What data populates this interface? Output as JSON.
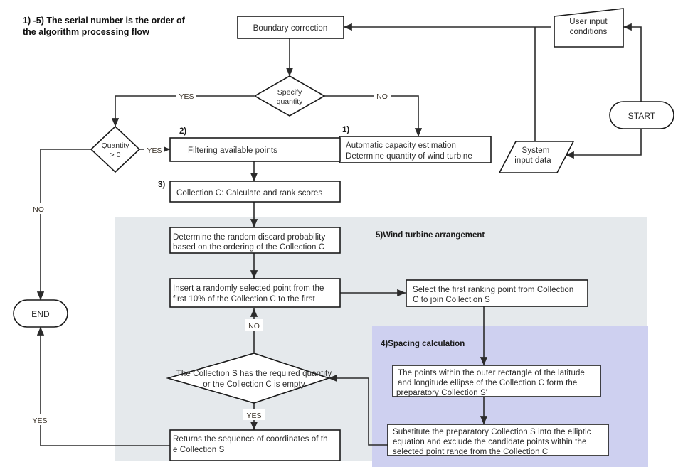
{
  "header": {
    "note_line1": "1)  -5)  The serial number is the order of",
    "note_line2": "the algorithm processing flow"
  },
  "bands": [
    {
      "id": "wind-turbine-arrangement",
      "label": "5)Wind turbine arrangement",
      "color": "#e5e9ec"
    },
    {
      "id": "spacing-calculation",
      "label": "4)Spacing calculation",
      "color": "#ced0f0"
    }
  ],
  "nodes": {
    "start": {
      "label": "START",
      "shape": "terminator"
    },
    "end": {
      "label": "END",
      "shape": "terminator"
    },
    "user_input": {
      "label_line1": "User input",
      "label_line2": "conditions",
      "shape": "trapezoid"
    },
    "system_input": {
      "label_line1": "System",
      "label_line2": "input data",
      "shape": "parallelogram"
    },
    "boundary_correction": {
      "label": "Boundary correction",
      "shape": "process"
    },
    "specify_quantity": {
      "label_line1": "Specify",
      "label_line2": "quantity",
      "shape": "decision"
    },
    "quantity_gt_zero": {
      "label_line1": "Quantity",
      "label_line2": "> 0",
      "shape": "decision"
    },
    "auto_capacity": {
      "step": "1)",
      "label_line1": "Automatic capacity estimation",
      "label_line2": "Determine quantity of wind turbine",
      "shape": "process"
    },
    "filtering_points": {
      "step": "2)",
      "label": "Filtering available points",
      "shape": "process"
    },
    "collection_c_scores": {
      "step": "3)",
      "label": "Collection C:   Calculate and rank scores",
      "shape": "process"
    },
    "discard_probability": {
      "label_line1": "Determine the random discard probability",
      "label_line2": "based on the ordering of the Collection C",
      "shape": "process"
    },
    "insert_random_point": {
      "label_line1": "Insert a randomly selected point from the",
      "label_line2": "first 10% of the Collection C to the first",
      "shape": "process"
    },
    "select_first_ranking": {
      "label_line1": "Select the first ranking point from Collection",
      "label_line2": " C to join Collection S",
      "shape": "process"
    },
    "outer_rectangle_points": {
      "label_line1": "The points within the outer rectangle of the latitude",
      "label_line2": " and longitude ellipse of the Collection C form the",
      "label_line3": "preparatory Collection S'",
      "shape": "process"
    },
    "substitute_elliptic": {
      "label_line1": "Substitute the preparatory Collection S into the elliptic",
      "label_line2": "equation and exclude the candidate points within the",
      "label_line3": "selected point range from the Collection C",
      "shape": "process"
    },
    "collection_s_check": {
      "label_line1": "The Collection S has the required quantity",
      "label_line2": "or the Collection C is empty",
      "shape": "decision"
    },
    "return_sequence": {
      "label_line1": "Returns the sequence of coordinates of th",
      "label_line2": "e Collection S",
      "shape": "process"
    }
  },
  "edge_labels": {
    "specify_yes": "YES",
    "specify_no": "NO",
    "quantity_yes": "YES",
    "quantity_no": "NO",
    "loop_no": "NO",
    "loop_yes": "YES",
    "end_yes": "YES"
  },
  "colors": {
    "stroke": "#2b2b2b",
    "band_gray": "#e5e9ec",
    "band_purple": "#ced0f0",
    "text": "#2b2b2b",
    "edge_label": "#3a3228"
  }
}
